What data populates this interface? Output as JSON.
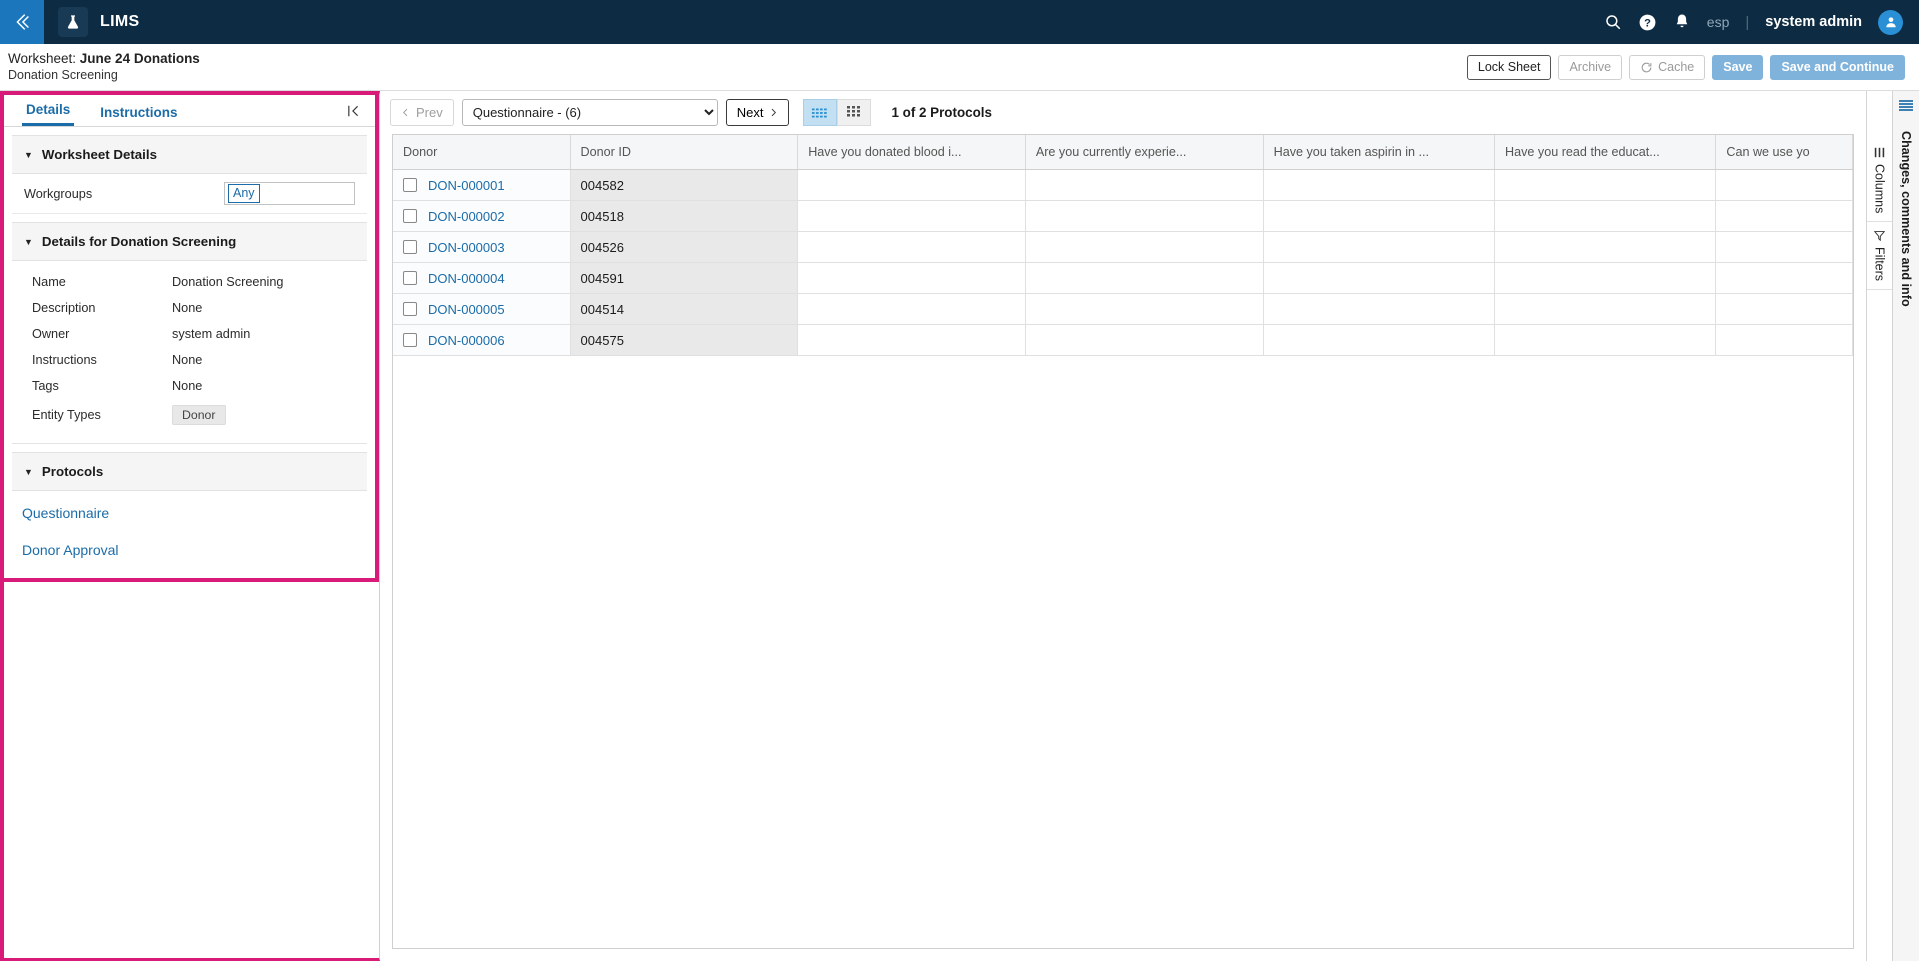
{
  "appbar": {
    "back_icon": "chevron-left-icon",
    "logo_icon": "flask-icon",
    "brand": "LIMS",
    "search_icon": "search-icon",
    "help_icon": "help-icon",
    "notifications_icon": "bell-icon",
    "locale": "esp",
    "separator": "|",
    "username": "system admin",
    "avatar_icon": "user-avatar-icon"
  },
  "titlebar": {
    "prefix": "Worksheet:",
    "name": "June 24 Donations",
    "subtitle": "Donation Screening",
    "actions": {
      "lock_sheet": "Lock Sheet",
      "archive": "Archive",
      "cache": "Cache",
      "cache_icon": "refresh-icon",
      "save": "Save",
      "save_and_continue": "Save and Continue"
    }
  },
  "left_panel": {
    "tabs": [
      {
        "label": "Details",
        "active": true
      },
      {
        "label": "Instructions",
        "active": false
      }
    ],
    "collapse_icon": "collapse-panel-icon",
    "worksheet_details": {
      "title": "Worksheet Details",
      "caret_icon": "caret-down-icon",
      "workgroups_label": "Workgroups",
      "workgroups_value": "Any"
    },
    "details_section": {
      "title": "Details for Donation Screening",
      "caret_icon": "caret-down-icon",
      "rows": [
        {
          "key": "Name",
          "value": "Donation Screening"
        },
        {
          "key": "Description",
          "value": "None"
        },
        {
          "key": "Owner",
          "value": "system admin"
        },
        {
          "key": "Instructions",
          "value": "None"
        },
        {
          "key": "Tags",
          "value": "None"
        }
      ],
      "entity_types_label": "Entity Types",
      "entity_types_chip": "Donor"
    },
    "protocols_section": {
      "title": "Protocols",
      "caret_icon": "caret-down-icon",
      "items": [
        "Questionnaire",
        "Donor Approval"
      ]
    },
    "highlight_color": "#d81b78"
  },
  "grid_toolbar": {
    "prev_label": "Prev",
    "prev_icon": "chevron-left-icon",
    "next_label": "Next",
    "next_icon": "chevron-right-icon",
    "protocol_select_value": "Questionnaire - (6)",
    "protocol_select_options": [
      "Questionnaire - (6)",
      "Donor Approval"
    ],
    "view_grid_icon": "dense-grid-icon",
    "view_card_icon": "table-grid-icon",
    "protocol_count": "1 of 2 Protocols"
  },
  "table": {
    "columns": [
      "Donor",
      "Donor ID",
      "Have you donated blood i...",
      "Are you currently experie...",
      "Have you taken aspirin in ...",
      "Have you read the educat...",
      "Can we use yo"
    ],
    "rows": [
      {
        "donor": "DON-000001",
        "donor_id": "004582",
        "a1": "",
        "a2": "",
        "a3": "",
        "a4": "",
        "a5": ""
      },
      {
        "donor": "DON-000002",
        "donor_id": "004518",
        "a1": "",
        "a2": "",
        "a3": "",
        "a4": "",
        "a5": ""
      },
      {
        "donor": "DON-000003",
        "donor_id": "004526",
        "a1": "",
        "a2": "",
        "a3": "",
        "a4": "",
        "a5": ""
      },
      {
        "donor": "DON-000004",
        "donor_id": "004591",
        "a1": "",
        "a2": "",
        "a3": "",
        "a4": "",
        "a5": ""
      },
      {
        "donor": "DON-000005",
        "donor_id": "004514",
        "a1": "",
        "a2": "",
        "a3": "",
        "a4": "",
        "a5": ""
      },
      {
        "donor": "DON-000006",
        "donor_id": "004575",
        "a1": "",
        "a2": "",
        "a3": "",
        "a4": "",
        "a5": ""
      }
    ]
  },
  "right_rail": {
    "columns_label": "Columns",
    "columns_icon": "columns-icon",
    "filters_label": "Filters",
    "filters_icon": "filter-icon",
    "panel_icon": "menu-lines-icon",
    "panel_label": "Changes, comments and info"
  }
}
